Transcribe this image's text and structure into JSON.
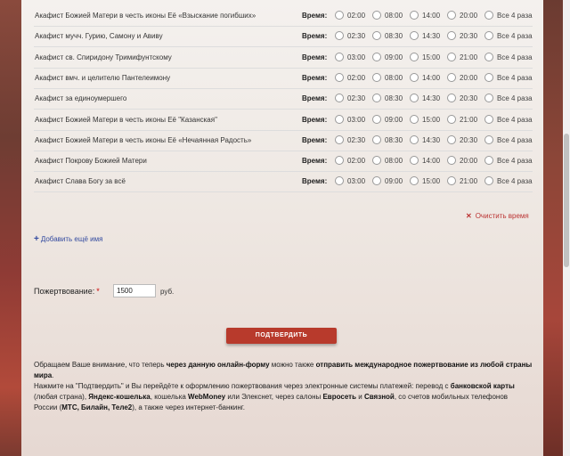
{
  "akathists": [
    {
      "name": "Акафист Божией Матери в честь иконы Её «Взыскание погибших»",
      "times": [
        "02:00",
        "08:00",
        "14:00",
        "20:00"
      ]
    },
    {
      "name": "Акафист мучч. Гурию, Самону и Авиву",
      "times": [
        "02:30",
        "08:30",
        "14:30",
        "20:30"
      ]
    },
    {
      "name": "Акафист св. Спиридону Тримифунтскому",
      "times": [
        "03:00",
        "09:00",
        "15:00",
        "21:00"
      ]
    },
    {
      "name": "Акафист вмч. и целителю Пантелеимону",
      "times": [
        "02:00",
        "08:00",
        "14:00",
        "20:00"
      ]
    },
    {
      "name": "Акафист за единоумершего",
      "times": [
        "02:30",
        "08:30",
        "14:30",
        "20:30"
      ]
    },
    {
      "name": "Акафист Божией Матери в честь иконы Её \"Казанская\"",
      "times": [
        "03:00",
        "09:00",
        "15:00",
        "21:00"
      ]
    },
    {
      "name": "Акафист Божией Матери в честь иконы Её «Нечаянная Радость»",
      "times": [
        "02:30",
        "08:30",
        "14:30",
        "20:30"
      ]
    },
    {
      "name": "Акафист Покрову Божией Матери",
      "times": [
        "02:00",
        "08:00",
        "14:00",
        "20:00"
      ]
    },
    {
      "name": "Акафист Слава Богу за всё",
      "times": [
        "03:00",
        "09:00",
        "15:00",
        "21:00"
      ]
    }
  ],
  "time_label": "Время:",
  "all_label": "Все 4 раза",
  "clear_label": "Очистить время",
  "add_label": "Добавить ещё имя",
  "donation": {
    "label": "Пожертвование:",
    "required_mark": "*",
    "value": "1500",
    "currency": "руб."
  },
  "confirm_label": "ПОДТВЕРДИТЬ",
  "notice": {
    "p1_a": "Обращаем Ваше внимание, что теперь ",
    "p1_b": "через данную онлайн-форму",
    "p1_c": " можно также ",
    "p1_d": "отправить международное пожертвование из любой страны мира",
    "p1_e": ".",
    "p2_a": "Нажмите на \"Подтвердить\" и Вы перейдёте к оформлению пожертвования через электронные системы платежей: перевод с ",
    "p2_b": "банковской карты",
    "p2_c": " (любая страна), ",
    "p2_d": "Яндекс-кошелька",
    "p2_e": ", кошелька ",
    "p2_f": "WebMoney",
    "p2_g": " или Элекснет, через салоны ",
    "p2_h": "Евросеть",
    "p2_i": " и ",
    "p2_j": "Связной",
    "p2_k": ", со счетов мобильных телефонов России (",
    "p2_l": "МТС, Билайн, Теле2",
    "p2_m": "), а также через интернет-банкинг."
  }
}
